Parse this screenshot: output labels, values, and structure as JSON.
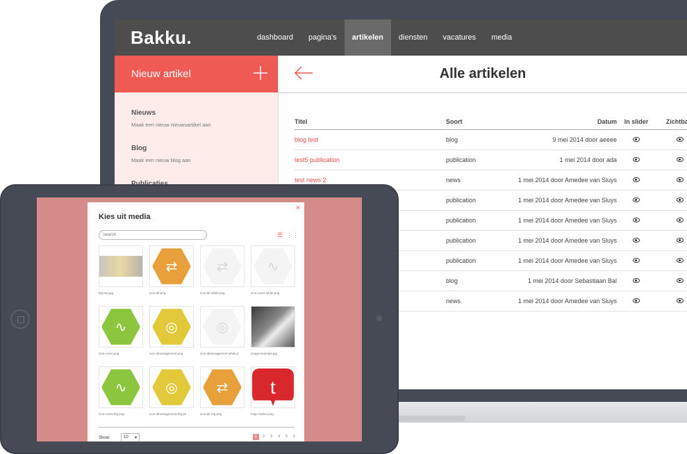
{
  "app": {
    "logo": "Bakku.",
    "nav": [
      "dashboard",
      "pagina's",
      "artikelen",
      "diensten",
      "vacatures",
      "media"
    ],
    "active_nav": "artikelen"
  },
  "sidebar": {
    "new_button": "Nieuw artikel",
    "plus_icon": "plus-icon",
    "sections": [
      {
        "title": "Nieuws",
        "desc": "Maak een nieuw nieuwsartikel aan"
      },
      {
        "title": "Blog",
        "desc": "Maak een nieuw blog aan"
      },
      {
        "title": "Publicaties",
        "desc": ""
      }
    ]
  },
  "content": {
    "title": "Alle artikelen",
    "back_icon": "arrow-left-icon",
    "table": {
      "headers": [
        "Titel",
        "Soort",
        "Datum",
        "In slider",
        "Zichtbaar"
      ],
      "rows": [
        {
          "title": "blog test",
          "type": "blog",
          "date": "9 mei 2014 door aeeee"
        },
        {
          "title": "test5 publication",
          "type": "publication",
          "date": "1 mei 2014 door ada"
        },
        {
          "title": "test news 2",
          "type": "news",
          "date": "1 mei 2014 door Amedee van Sluys"
        },
        {
          "title": "",
          "type": "publication",
          "date": "1 mei 2014 door Amedee van Sluys"
        },
        {
          "title": "",
          "type": "publication",
          "date": "1 mei 2014 door Amedee van Sluys"
        },
        {
          "title": "",
          "type": "publication",
          "date": "1 mei 2014 door Amedee van Sluys"
        },
        {
          "title": "",
          "type": "publication",
          "date": "1 mei 2014 door Amedee van Sluys"
        },
        {
          "title": "",
          "type": "blog",
          "date": "1 mei 2014 door Sebastiaan Bal"
        },
        {
          "title": "",
          "type": "news",
          "date": "1 mei 2014 door Amedee van Sluys"
        }
      ]
    }
  },
  "modal": {
    "title": "Kies uit media",
    "search_placeholder": "Search",
    "close_label": "×",
    "items": [
      {
        "label": "big-top.jpg",
        "kind": "photo"
      },
      {
        "label": "icon-dir.png",
        "kind": "hex",
        "color": "#e8a13a",
        "glyph": "⇄"
      },
      {
        "label": "icon-dir-white.png",
        "kind": "hex",
        "color": "#f4f4f4",
        "glyph": "⇄"
      },
      {
        "label": "icon-coms-white.png",
        "kind": "hex",
        "color": "#f4f4f4",
        "glyph": "∿"
      },
      {
        "label": "icon-coms.png",
        "kind": "hex",
        "color": "#8cc63f",
        "glyph": "∿"
      },
      {
        "label": "icon-idmanagement.png",
        "kind": "hex",
        "color": "#e2c93a",
        "glyph": "◎"
      },
      {
        "label": "icon-idmanagement-white.p",
        "kind": "hex",
        "color": "#f4f4f4",
        "glyph": "◎"
      },
      {
        "label": "image-example.jpg",
        "kind": "photo-bw"
      },
      {
        "label": "icon-coms-big.png",
        "kind": "hex",
        "color": "#8cc63f",
        "glyph": "∿"
      },
      {
        "label": "icon-idmanagement-big.pn",
        "kind": "hex",
        "color": "#e2c93a",
        "glyph": "◎"
      },
      {
        "label": "icon-dir-big.png",
        "kind": "hex",
        "color": "#e8a13a",
        "glyph": "⇄"
      },
      {
        "label": "map-marker.png",
        "kind": "marker",
        "color": "#d8282e",
        "glyph": "t"
      }
    ],
    "show_label": "Show:",
    "show_value": "10",
    "pages": [
      "1",
      "2",
      "3",
      "4",
      "5",
      "6"
    ],
    "active_page": "1"
  }
}
